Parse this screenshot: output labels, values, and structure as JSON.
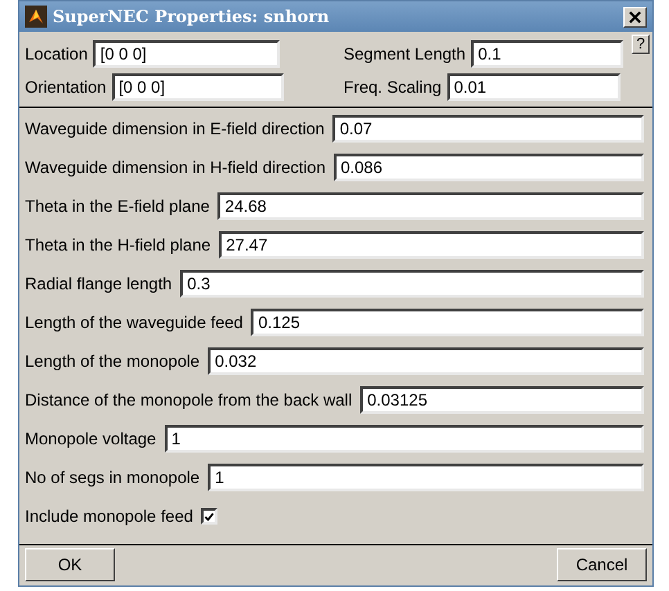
{
  "window": {
    "title": "SuperNEC Properties: snhorn"
  },
  "help": "?",
  "header_fields": [
    {
      "label": "Location",
      "value": "[0 0 0]"
    },
    {
      "label": "Segment Length",
      "value": "0.1"
    },
    {
      "label": "Orientation",
      "value": "[0 0 0]"
    },
    {
      "label": "Freq. Scaling",
      "value": "0.01"
    }
  ],
  "parameters": [
    {
      "kind": "text",
      "label": "Waveguide dimension in E-field direction",
      "value": "0.07"
    },
    {
      "kind": "text",
      "label": "Waveguide dimension in H-field direction",
      "value": "0.086"
    },
    {
      "kind": "text",
      "label": "Theta in the E-field plane",
      "value": "24.68"
    },
    {
      "kind": "text",
      "label": "Theta in the H-field plane",
      "value": "27.47"
    },
    {
      "kind": "text",
      "label": "Radial flange length",
      "value": "0.3"
    },
    {
      "kind": "text",
      "label": "Length of the waveguide feed",
      "value": "0.125"
    },
    {
      "kind": "text",
      "label": "Length of the monopole",
      "value": "0.032"
    },
    {
      "kind": "text",
      "label": "Distance of the monopole from the back wall",
      "value": "0.03125"
    },
    {
      "kind": "text",
      "label": "Monopole voltage",
      "value": "1"
    },
    {
      "kind": "text",
      "label": "No of segs in monopole",
      "value": "1"
    },
    {
      "kind": "checkbox",
      "label": "Include monopole feed",
      "checked": true
    }
  ],
  "buttons": [
    "OK",
    "Cancel"
  ]
}
